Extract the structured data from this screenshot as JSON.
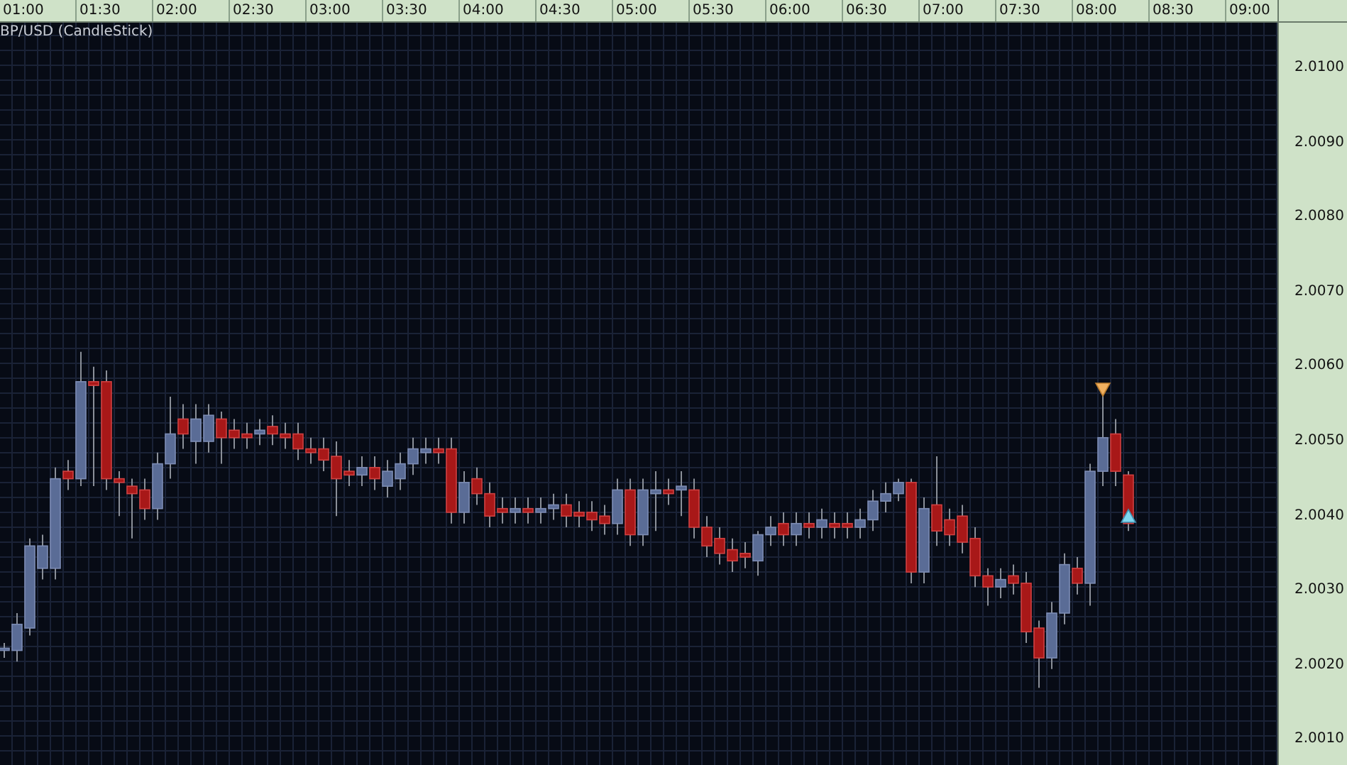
{
  "chart": {
    "title": "BP/USD (CandleStick)",
    "time_axis": [
      "01:00",
      "01:30",
      "02:00",
      "02:30",
      "03:00",
      "03:30",
      "04:00",
      "04:30",
      "05:00",
      "05:30",
      "06:00",
      "06:30",
      "07:00",
      "07:30",
      "08:00",
      "08:30",
      "09:00"
    ],
    "price_axis": [
      "2.0100",
      "2.0090",
      "2.0080",
      "2.0070",
      "2.0060",
      "2.0050",
      "2.0040",
      "2.0030",
      "2.0020",
      "2.0010"
    ]
  }
}
